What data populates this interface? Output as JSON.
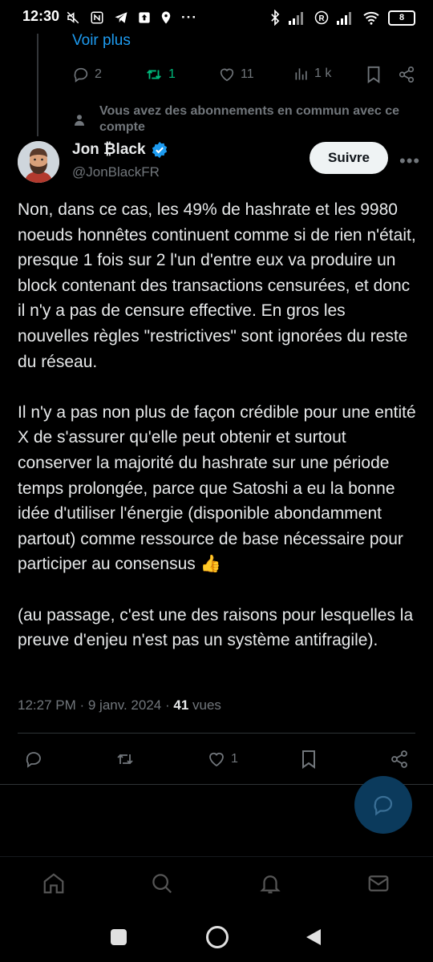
{
  "status_bar": {
    "time": "12:30",
    "left_icons": [
      "mute-icon",
      "nfc-icon",
      "telegram-icon",
      "upload-icon",
      "location-icon"
    ],
    "dots": "···",
    "right_icons": [
      "bluetooth-icon",
      "signal-icon",
      "registered-icon",
      "signal-icon",
      "wifi-icon"
    ],
    "battery": "8"
  },
  "prev_tweet": {
    "voir_plus": "Voir plus",
    "replies": "2",
    "retweets": "1",
    "likes": "11",
    "views": "1 k"
  },
  "social_context": "Vous avez des abonnements en commun avec ce compte",
  "tweet": {
    "author_name": "Jon ₿lack",
    "handle": "@JonBlackFR",
    "follow_label": "Suivre",
    "paragraphs": [
      "Non, dans ce cas, les 49% de hashrate et les 9980 noeuds honnêtes continuent comme si de rien n'était, presque 1 fois sur 2 l'un d'entre eux va produire un block contenant des transactions censurées, et donc il n'y a pas de censure effective. En gros les nouvelles règles \"restrictives\" sont ignorées du reste du réseau.",
      "Il n'y a pas non plus de façon crédible pour une entité X de s'assurer qu'elle peut obtenir et surtout conserver la majorité du hashrate sur une période temps prolongée, parce que Satoshi a eu la bonne idée d'utiliser l'énergie (disponible abondamment partout) comme ressource de base nécessaire pour participer au consensus 👍",
      "(au passage, c'est une des raisons pour lesquelles la preuve d'enjeu n'est pas un système antifragile)."
    ],
    "timestamp": "12:27 PM · 9 janv. 2024 · ",
    "views_count": "41",
    "views_label": " vues",
    "likes": "1"
  },
  "colors": {
    "accent": "#1d9bf0",
    "retweet": "#00ba7c",
    "muted": "#71767b",
    "text": "#e7e9ea",
    "background": "#000000"
  }
}
